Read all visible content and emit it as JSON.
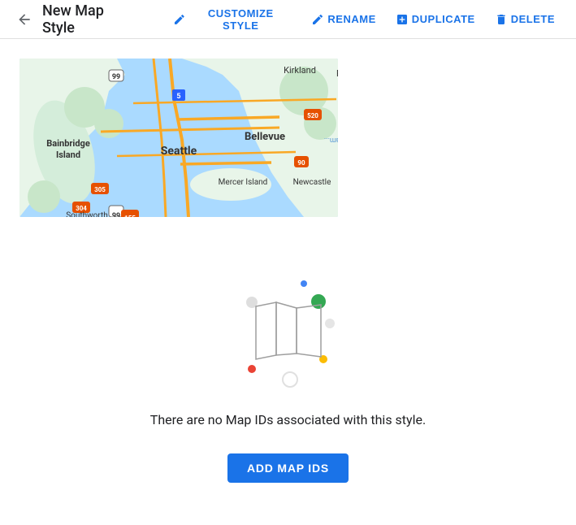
{
  "header": {
    "title": "New Map Style",
    "back_icon": "←",
    "actions": [
      {
        "id": "customize",
        "label": "CUSTOMIZE STYLE",
        "icon": "pencil"
      },
      {
        "id": "rename",
        "label": "RENAME",
        "icon": "pencil"
      },
      {
        "id": "duplicate",
        "label": "DUPLICATE",
        "icon": "duplicate"
      },
      {
        "id": "delete",
        "label": "DELETE",
        "icon": "trash"
      }
    ]
  },
  "empty_state": {
    "message": "There are no Map IDs associated with this style.",
    "add_button_label": "ADD MAP IDS"
  },
  "colors": {
    "primary_blue": "#1a73e8",
    "dot_green": "#34a853",
    "dot_red": "#ea4335",
    "dot_blue": "#4285f4",
    "dot_yellow": "#fbbc04",
    "dot_light": "#e0e0e0"
  }
}
